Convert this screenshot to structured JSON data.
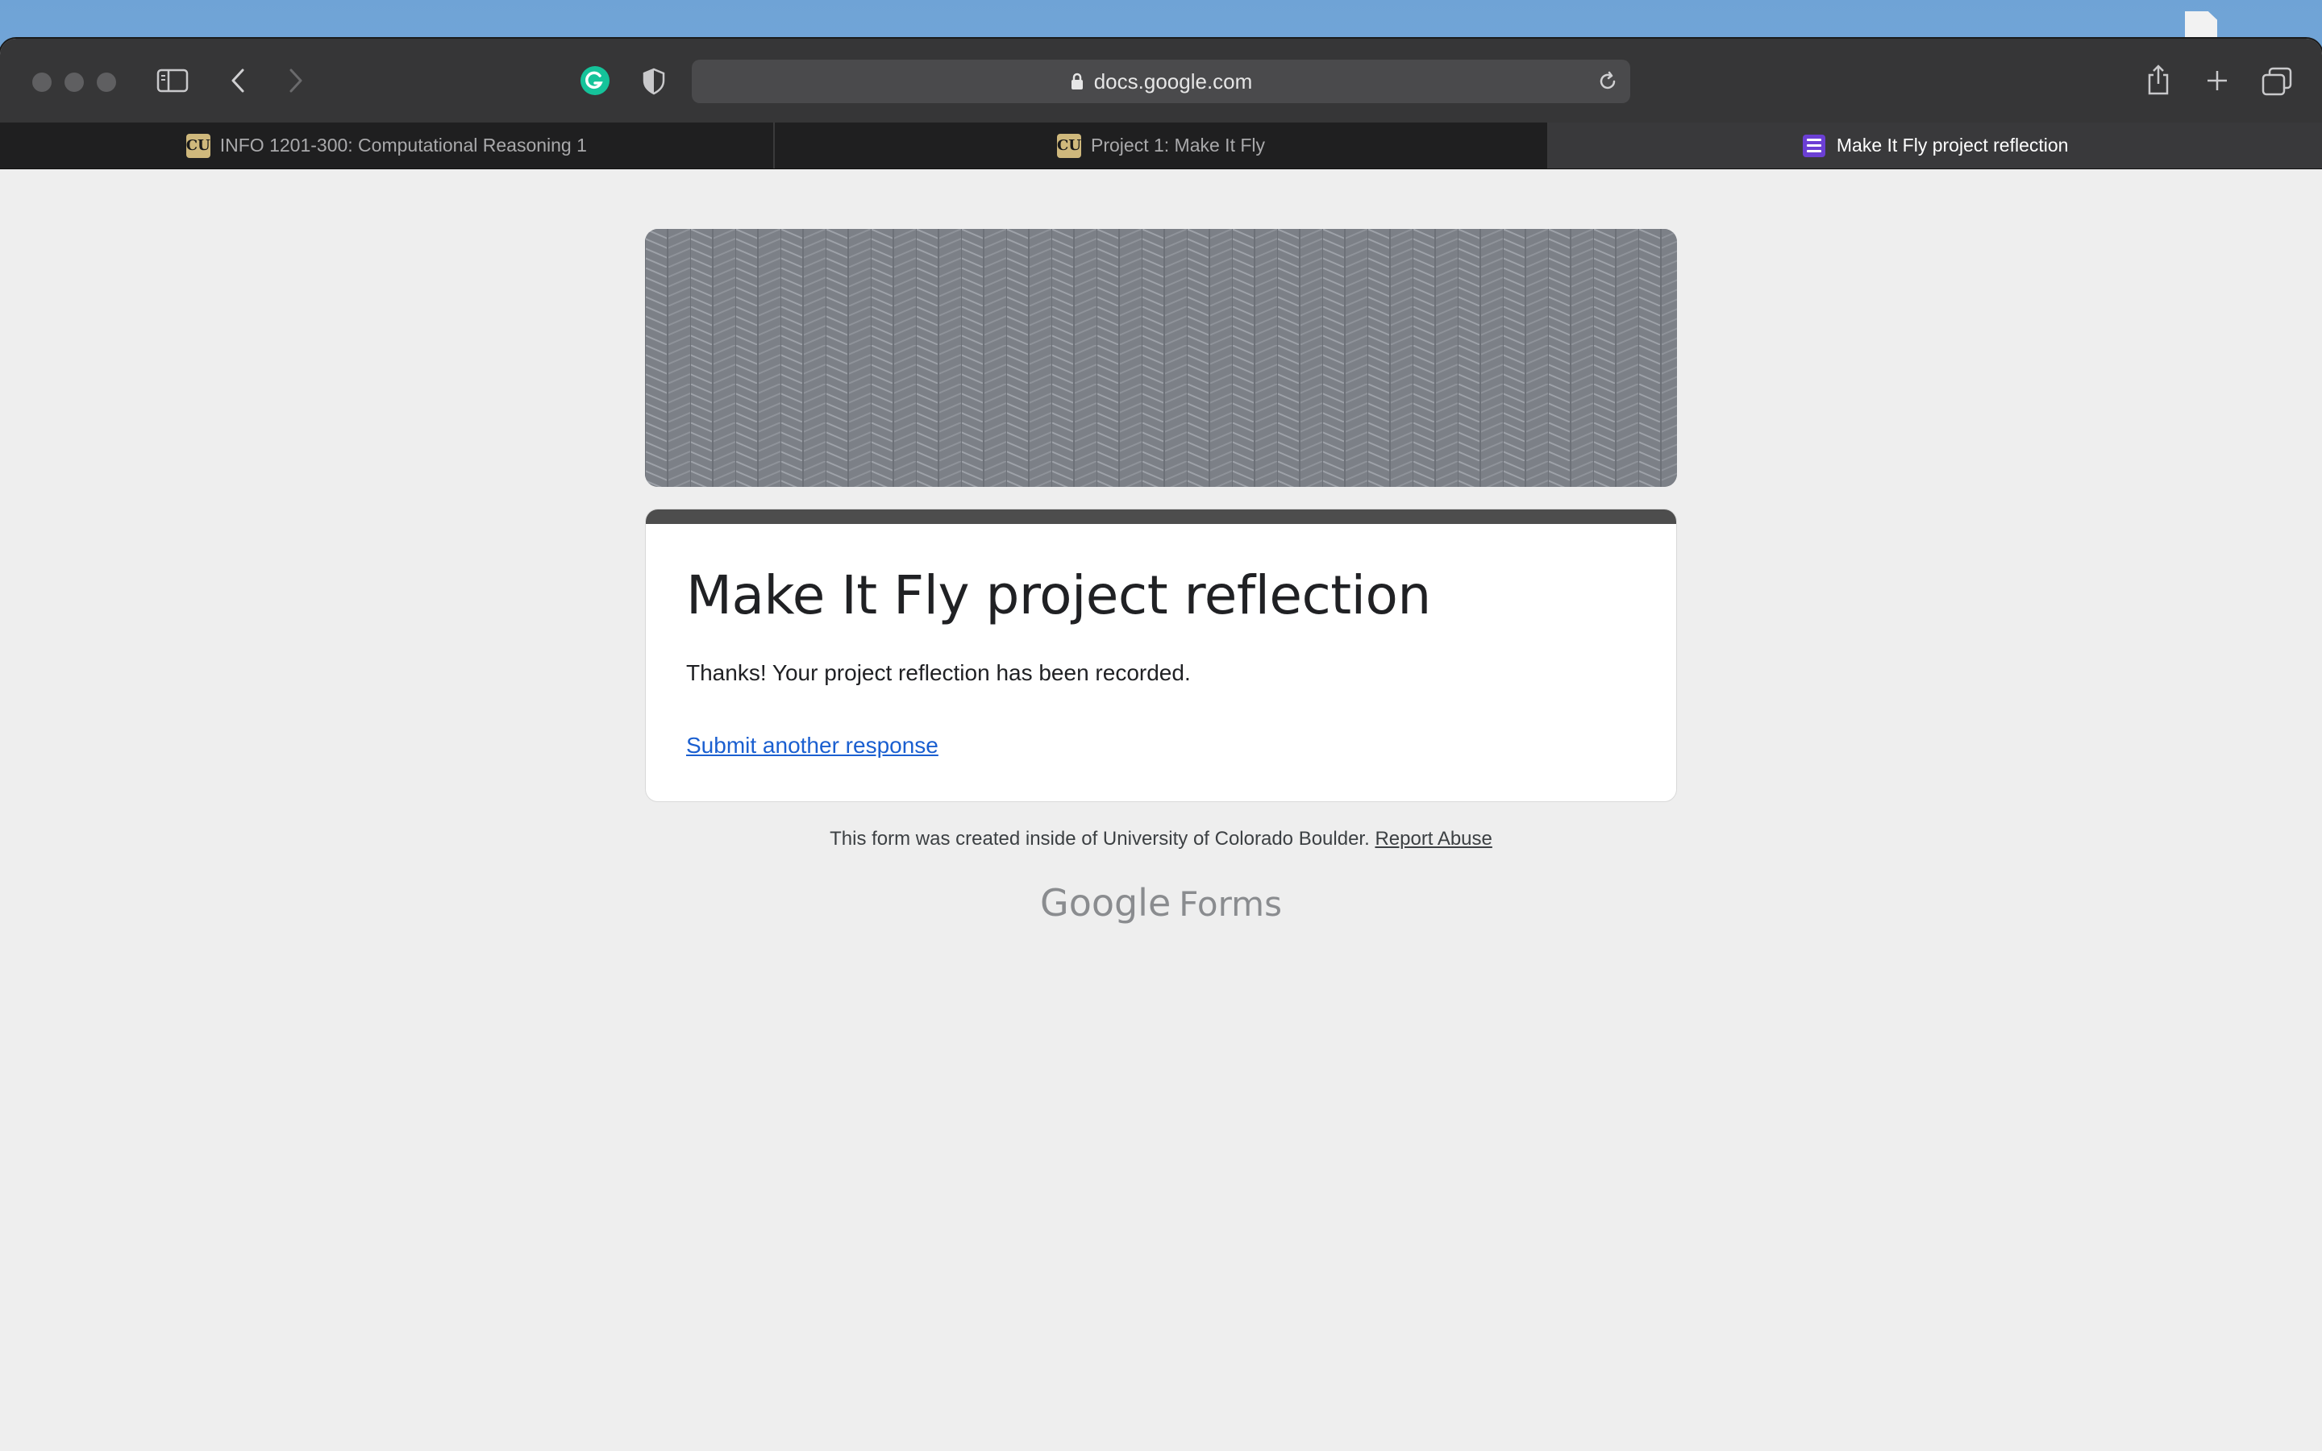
{
  "browser": {
    "url": "docs.google.com",
    "tabs": [
      {
        "label": "INFO 1201-300: Computational Reasoning 1",
        "icon": "cu-boulder-icon",
        "active": false
      },
      {
        "label": "Project 1: Make It Fly",
        "icon": "cu-boulder-icon",
        "active": false
      },
      {
        "label": "Make It Fly project reflection",
        "icon": "google-forms-icon",
        "active": true
      }
    ]
  },
  "form": {
    "title": "Make It Fly project reflection",
    "confirmation": "Thanks! Your project reflection has been recorded.",
    "submit_another": "Submit another response"
  },
  "footer": {
    "text": "This form was created inside of University of Colorado Boulder.",
    "report_abuse": "Report Abuse"
  },
  "branding": {
    "google": "Google",
    "forms": "Forms"
  },
  "colors": {
    "accent_bar": "#4d4d4d",
    "link": "#1a5fd0",
    "page_bg": "#eeeeee"
  }
}
